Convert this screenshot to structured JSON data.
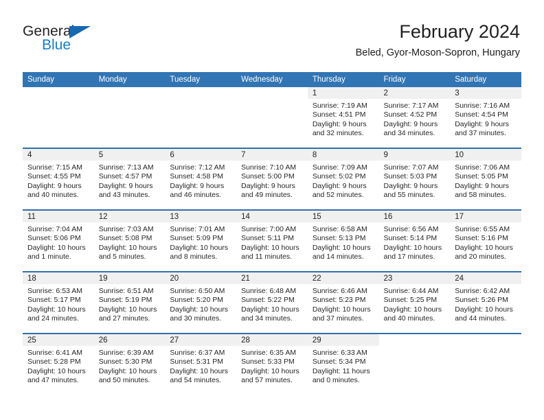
{
  "brand": {
    "name_part1": "General",
    "name_part2": "Blue",
    "triangle_color": "#1769b0",
    "blue_color": "#1a7bc4"
  },
  "header": {
    "title": "February 2024",
    "subtitle": "Beled, Gyor-Moson-Sopron, Hungary"
  },
  "theme": {
    "header_blue": "#3275b4",
    "row_rule_blue": "#2f6fad",
    "daynum_band_gray": "#f0f0f0"
  },
  "weekday_headers": [
    "Sunday",
    "Monday",
    "Tuesday",
    "Wednesday",
    "Thursday",
    "Friday",
    "Saturday"
  ],
  "weeks": [
    [
      {
        "day": "",
        "blank": true
      },
      {
        "day": "",
        "blank": true
      },
      {
        "day": "",
        "blank": true
      },
      {
        "day": "",
        "blank": true
      },
      {
        "day": "1",
        "sunrise": "Sunrise: 7:19 AM",
        "sunset": "Sunset: 4:51 PM",
        "daylight1": "Daylight: 9 hours",
        "daylight2": "and 32 minutes."
      },
      {
        "day": "2",
        "sunrise": "Sunrise: 7:17 AM",
        "sunset": "Sunset: 4:52 PM",
        "daylight1": "Daylight: 9 hours",
        "daylight2": "and 34 minutes."
      },
      {
        "day": "3",
        "sunrise": "Sunrise: 7:16 AM",
        "sunset": "Sunset: 4:54 PM",
        "daylight1": "Daylight: 9 hours",
        "daylight2": "and 37 minutes."
      }
    ],
    [
      {
        "day": "4",
        "sunrise": "Sunrise: 7:15 AM",
        "sunset": "Sunset: 4:55 PM",
        "daylight1": "Daylight: 9 hours",
        "daylight2": "and 40 minutes."
      },
      {
        "day": "5",
        "sunrise": "Sunrise: 7:13 AM",
        "sunset": "Sunset: 4:57 PM",
        "daylight1": "Daylight: 9 hours",
        "daylight2": "and 43 minutes."
      },
      {
        "day": "6",
        "sunrise": "Sunrise: 7:12 AM",
        "sunset": "Sunset: 4:58 PM",
        "daylight1": "Daylight: 9 hours",
        "daylight2": "and 46 minutes."
      },
      {
        "day": "7",
        "sunrise": "Sunrise: 7:10 AM",
        "sunset": "Sunset: 5:00 PM",
        "daylight1": "Daylight: 9 hours",
        "daylight2": "and 49 minutes."
      },
      {
        "day": "8",
        "sunrise": "Sunrise: 7:09 AM",
        "sunset": "Sunset: 5:02 PM",
        "daylight1": "Daylight: 9 hours",
        "daylight2": "and 52 minutes."
      },
      {
        "day": "9",
        "sunrise": "Sunrise: 7:07 AM",
        "sunset": "Sunset: 5:03 PM",
        "daylight1": "Daylight: 9 hours",
        "daylight2": "and 55 minutes."
      },
      {
        "day": "10",
        "sunrise": "Sunrise: 7:06 AM",
        "sunset": "Sunset: 5:05 PM",
        "daylight1": "Daylight: 9 hours",
        "daylight2": "and 58 minutes."
      }
    ],
    [
      {
        "day": "11",
        "sunrise": "Sunrise: 7:04 AM",
        "sunset": "Sunset: 5:06 PM",
        "daylight1": "Daylight: 10 hours",
        "daylight2": "and 1 minute."
      },
      {
        "day": "12",
        "sunrise": "Sunrise: 7:03 AM",
        "sunset": "Sunset: 5:08 PM",
        "daylight1": "Daylight: 10 hours",
        "daylight2": "and 5 minutes."
      },
      {
        "day": "13",
        "sunrise": "Sunrise: 7:01 AM",
        "sunset": "Sunset: 5:09 PM",
        "daylight1": "Daylight: 10 hours",
        "daylight2": "and 8 minutes."
      },
      {
        "day": "14",
        "sunrise": "Sunrise: 7:00 AM",
        "sunset": "Sunset: 5:11 PM",
        "daylight1": "Daylight: 10 hours",
        "daylight2": "and 11 minutes."
      },
      {
        "day": "15",
        "sunrise": "Sunrise: 6:58 AM",
        "sunset": "Sunset: 5:13 PM",
        "daylight1": "Daylight: 10 hours",
        "daylight2": "and 14 minutes."
      },
      {
        "day": "16",
        "sunrise": "Sunrise: 6:56 AM",
        "sunset": "Sunset: 5:14 PM",
        "daylight1": "Daylight: 10 hours",
        "daylight2": "and 17 minutes."
      },
      {
        "day": "17",
        "sunrise": "Sunrise: 6:55 AM",
        "sunset": "Sunset: 5:16 PM",
        "daylight1": "Daylight: 10 hours",
        "daylight2": "and 20 minutes."
      }
    ],
    [
      {
        "day": "18",
        "sunrise": "Sunrise: 6:53 AM",
        "sunset": "Sunset: 5:17 PM",
        "daylight1": "Daylight: 10 hours",
        "daylight2": "and 24 minutes."
      },
      {
        "day": "19",
        "sunrise": "Sunrise: 6:51 AM",
        "sunset": "Sunset: 5:19 PM",
        "daylight1": "Daylight: 10 hours",
        "daylight2": "and 27 minutes."
      },
      {
        "day": "20",
        "sunrise": "Sunrise: 6:50 AM",
        "sunset": "Sunset: 5:20 PM",
        "daylight1": "Daylight: 10 hours",
        "daylight2": "and 30 minutes."
      },
      {
        "day": "21",
        "sunrise": "Sunrise: 6:48 AM",
        "sunset": "Sunset: 5:22 PM",
        "daylight1": "Daylight: 10 hours",
        "daylight2": "and 34 minutes."
      },
      {
        "day": "22",
        "sunrise": "Sunrise: 6:46 AM",
        "sunset": "Sunset: 5:23 PM",
        "daylight1": "Daylight: 10 hours",
        "daylight2": "and 37 minutes."
      },
      {
        "day": "23",
        "sunrise": "Sunrise: 6:44 AM",
        "sunset": "Sunset: 5:25 PM",
        "daylight1": "Daylight: 10 hours",
        "daylight2": "and 40 minutes."
      },
      {
        "day": "24",
        "sunrise": "Sunrise: 6:42 AM",
        "sunset": "Sunset: 5:26 PM",
        "daylight1": "Daylight: 10 hours",
        "daylight2": "and 44 minutes."
      }
    ],
    [
      {
        "day": "25",
        "sunrise": "Sunrise: 6:41 AM",
        "sunset": "Sunset: 5:28 PM",
        "daylight1": "Daylight: 10 hours",
        "daylight2": "and 47 minutes."
      },
      {
        "day": "26",
        "sunrise": "Sunrise: 6:39 AM",
        "sunset": "Sunset: 5:30 PM",
        "daylight1": "Daylight: 10 hours",
        "daylight2": "and 50 minutes."
      },
      {
        "day": "27",
        "sunrise": "Sunrise: 6:37 AM",
        "sunset": "Sunset: 5:31 PM",
        "daylight1": "Daylight: 10 hours",
        "daylight2": "and 54 minutes."
      },
      {
        "day": "28",
        "sunrise": "Sunrise: 6:35 AM",
        "sunset": "Sunset: 5:33 PM",
        "daylight1": "Daylight: 10 hours",
        "daylight2": "and 57 minutes."
      },
      {
        "day": "29",
        "sunrise": "Sunrise: 6:33 AM",
        "sunset": "Sunset: 5:34 PM",
        "daylight1": "Daylight: 11 hours",
        "daylight2": "and 0 minutes."
      },
      {
        "day": "",
        "blank": true
      },
      {
        "day": "",
        "blank": true
      }
    ]
  ]
}
